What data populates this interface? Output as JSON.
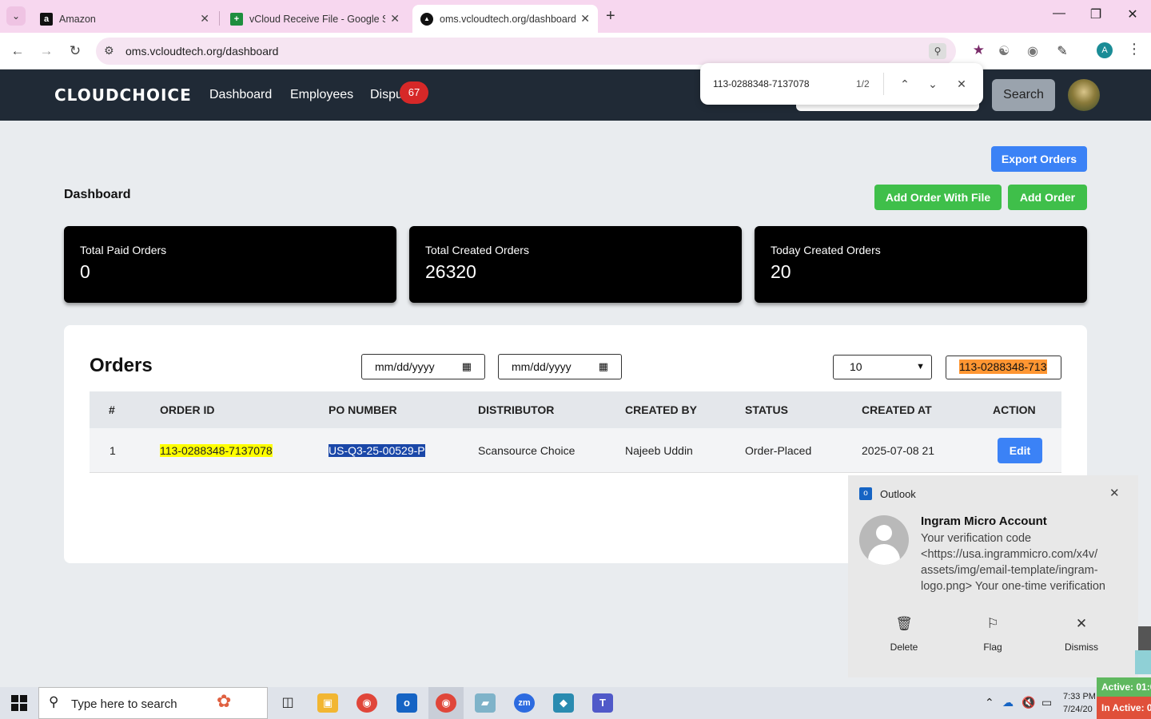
{
  "browser": {
    "tabs": [
      {
        "label": "Amazon",
        "favicon": "amazon-icon"
      },
      {
        "label": "vCloud Receive File - Google Sh",
        "favicon": "sheets-icon"
      },
      {
        "label": "oms.vcloudtech.org/dashboard",
        "favicon": "site-icon"
      }
    ],
    "url": "oms.vcloudtech.org/dashboard",
    "profile_initial": "A"
  },
  "find_bar": {
    "query": "113-0288348-7137078",
    "count": "1/2"
  },
  "app_nav": {
    "logo": "CLOUDCHOICE",
    "links": [
      "Dashboard",
      "Employees",
      "Dispu"
    ],
    "disputes_badge": "67",
    "search_button": "Search"
  },
  "dashboard": {
    "title": "Dashboard",
    "buttons": {
      "export": "Export Orders",
      "add_with_file": "Add Order With File",
      "add": "Add Order"
    },
    "stats": [
      {
        "label": "Total Paid Orders",
        "value": "0"
      },
      {
        "label": "Total Created Orders",
        "value": "26320"
      },
      {
        "label": "Today Created Orders",
        "value": "20"
      }
    ]
  },
  "orders": {
    "title": "Orders",
    "date_from_placeholder": "mm/dd/yyyy",
    "date_to_placeholder": "mm/dd/yyyy",
    "page_size": "10",
    "search_value": "113-0288348-713",
    "columns": [
      "#",
      "ORDER ID",
      "PO NUMBER",
      "DISTRIBUTOR",
      "CREATED BY",
      "STATUS",
      "CREATED AT",
      "ACTION"
    ],
    "rows": [
      {
        "num": "1",
        "order_id": "113-0288348-7137078",
        "po_number": "US-Q3-25-00529-P",
        "distributor": "Scansource Choice",
        "created_by": "Najeeb Uddin",
        "status": "Order-Placed",
        "created_at": "2025-07-08 21",
        "action": "Edit"
      }
    ]
  },
  "notification": {
    "app": "Outlook",
    "sender": "Ingram Micro Account",
    "body": "Your verification code <https://usa.ingrammicro.com/x4v/ assets/img/email-template/ingram-logo.png>   Your one-time verification",
    "actions": [
      "Delete",
      "Flag",
      "Dismiss"
    ]
  },
  "taskbar": {
    "search_placeholder": "Type here to search",
    "time": "7:33 PM",
    "date": "7/24/20",
    "active_label": "Active: 01:0",
    "inactive_label": "In Active: 0"
  },
  "colors": {
    "nav_bg": "#202a36",
    "primary_blue": "#3b82f6",
    "green": "#3fbf4a",
    "find_highlight": "#ffff00",
    "active_match": "#ff9632"
  }
}
